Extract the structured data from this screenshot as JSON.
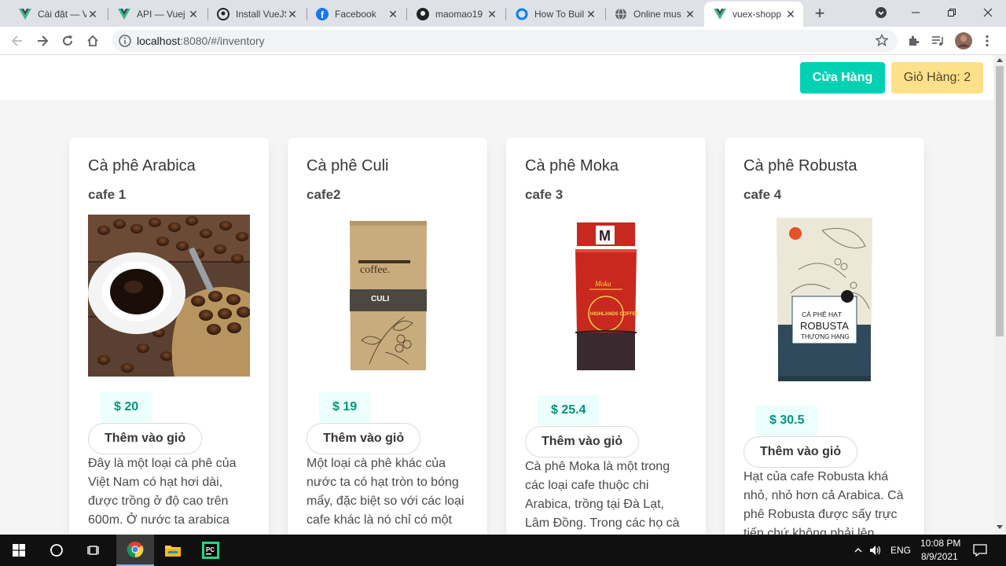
{
  "browser": {
    "tabs": [
      {
        "title": "Cài đặt — V",
        "icon": "vue-icon"
      },
      {
        "title": "API — Vuej",
        "icon": "vue-icon"
      },
      {
        "title": "Install VueJS",
        "icon": "github-icon"
      },
      {
        "title": "Facebook",
        "icon": "facebook-icon"
      },
      {
        "title": "maomao19",
        "icon": "github-icon"
      },
      {
        "title": "How To Buil",
        "icon": "digitalocean-icon"
      },
      {
        "title": "Online mus",
        "icon": "globe-icon"
      },
      {
        "title": "vuex-shopp",
        "icon": "vue-icon"
      }
    ],
    "url_host": "localhost",
    "url_rest": ":8080/#/inventory"
  },
  "header": {
    "store_label": "Cửa Hàng",
    "cart_label": "Giỏ Hàng: 2"
  },
  "products": [
    {
      "name": "Cà phê Arabica",
      "subtitle": "cafe 1",
      "price": "$ 20",
      "add_label": "Thêm vào giỏ",
      "desc": [
        "Đây là một loại cà phê của",
        "Việt Nam có hạt hơi dài,",
        "được trồng ở độ cao trên",
        "600m. Ở nước ta arabica"
      ]
    },
    {
      "name": "Cà phê Culi",
      "subtitle": "cafe2",
      "price": "$ 19",
      "add_label": "Thêm vào giỏ",
      "desc": [
        "Một loại cà phê khác của",
        "nước ta có hạt tròn to bóng",
        "mẩy, đặc biệt so với các loại",
        "cafe khác là nó chỉ có một"
      ],
      "package_text": {
        "brand": "coffee.",
        "label": "CULI"
      }
    },
    {
      "name": "Cà phê Moka",
      "subtitle": "cafe 3",
      "price": "$ 25.4",
      "add_label": "Thêm vào giỏ",
      "desc": [
        "Cà phê Moka là một trong",
        "các loại cafe thuộc chi",
        "Arabica, trồng tại Đà Lạt,",
        "Lâm Đồng. Trong các họ cà"
      ],
      "package_text": {
        "letter": "M",
        "label": "Moka",
        "brand": "HIGHLANDS COFFEE"
      }
    },
    {
      "name": "Cà phê Robusta",
      "subtitle": "cafe 4",
      "price": "$ 30.5",
      "add_label": "Thêm vào giỏ",
      "desc": [
        "Hạt của cafe Robusta khá",
        "nhỏ, nhỏ hơn cả Arabica. Cà",
        "phê Robusta được sấy trực",
        "tiếp chứ không phải lên"
      ],
      "package_text": {
        "line1": "CÀ PHÊ HẠT",
        "line2": "ROBUSTA",
        "line3": "THƯỢNG HẠNG"
      }
    }
  ],
  "taskbar": {
    "lang": "ENG",
    "time": "10:08 PM",
    "date": "8/9/2021"
  }
}
